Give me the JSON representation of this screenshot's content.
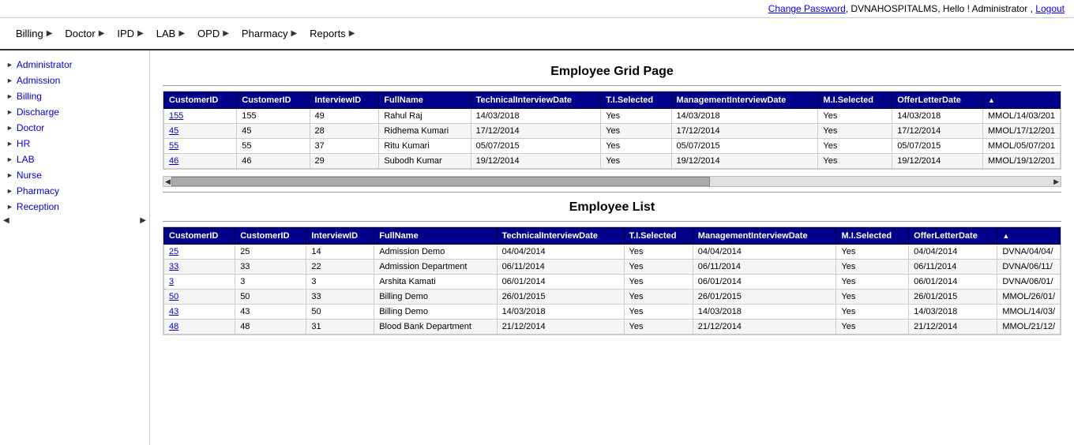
{
  "topbar": {
    "change_password": "Change Password",
    "hospital": "DVNAHOSPITALMS",
    "hello": "Hello ! Administrator",
    "logout": "Logout"
  },
  "nav": {
    "items": [
      {
        "label": "Billing",
        "id": "billing"
      },
      {
        "label": "Doctor",
        "id": "doctor"
      },
      {
        "label": "IPD",
        "id": "ipd"
      },
      {
        "label": "LAB",
        "id": "lab"
      },
      {
        "label": "OPD",
        "id": "opd"
      },
      {
        "label": "Pharmacy",
        "id": "pharmacy"
      },
      {
        "label": "Reports",
        "id": "reports"
      }
    ]
  },
  "sidebar": {
    "items": [
      {
        "label": "Administrator",
        "id": "administrator"
      },
      {
        "label": "Admission",
        "id": "admission"
      },
      {
        "label": "Billing",
        "id": "billing"
      },
      {
        "label": "Discharge",
        "id": "discharge"
      },
      {
        "label": "Doctor",
        "id": "doctor"
      },
      {
        "label": "HR",
        "id": "hr"
      },
      {
        "label": "LAB",
        "id": "lab"
      },
      {
        "label": "Nurse",
        "id": "nurse"
      },
      {
        "label": "Pharmacy",
        "id": "pharmacy"
      },
      {
        "label": "Reception",
        "id": "reception"
      }
    ]
  },
  "employee_grid": {
    "title": "Employee Grid Page",
    "columns": [
      "CustomerID",
      "CustomerID",
      "InterviewID",
      "FullName",
      "TechnicalInterviewDate",
      "T.I.Selected",
      "ManagementInterviewDate",
      "M.I.Selected",
      "OfferLetterDate",
      ""
    ],
    "rows": [
      {
        "id": "155",
        "cid": "155",
        "iid": "49",
        "name": "Rahul Raj",
        "tid": "14/03/2018",
        "tis": "Yes",
        "mid": "14/03/2018",
        "mis": "Yes",
        "old": "14/03/2018",
        "ol": "MMOL/14/03/201"
      },
      {
        "id": "45",
        "cid": "45",
        "iid": "28",
        "name": "Ridhema Kumari",
        "tid": "17/12/2014",
        "tis": "Yes",
        "mid": "17/12/2014",
        "mis": "Yes",
        "old": "17/12/2014",
        "ol": "MMOL/17/12/201"
      },
      {
        "id": "55",
        "cid": "55",
        "iid": "37",
        "name": "Ritu Kumari",
        "tid": "05/07/2015",
        "tis": "Yes",
        "mid": "05/07/2015",
        "mis": "Yes",
        "old": "05/07/2015",
        "ol": "MMOL/05/07/201"
      },
      {
        "id": "46",
        "cid": "46",
        "iid": "29",
        "name": "Subodh Kumar",
        "tid": "19/12/2014",
        "tis": "Yes",
        "mid": "19/12/2014",
        "mis": "Yes",
        "old": "19/12/2014",
        "ol": "MMOL/19/12/201"
      }
    ]
  },
  "employee_list": {
    "title": "Employee List",
    "columns": [
      "CustomerID",
      "CustomerID",
      "InterviewID",
      "FullName",
      "TechnicalInterviewDate",
      "T.I.Selected",
      "ManagementInterviewDate",
      "M.I.Selected",
      "OfferLetterDate",
      ""
    ],
    "rows": [
      {
        "id": "25",
        "cid": "25",
        "iid": "14",
        "name": "Admission Demo",
        "tid": "04/04/2014",
        "tis": "Yes",
        "mid": "04/04/2014",
        "mis": "Yes",
        "old": "04/04/2014",
        "ol": "DVNA/04/04/"
      },
      {
        "id": "33",
        "cid": "33",
        "iid": "22",
        "name": "Admission Department",
        "tid": "06/11/2014",
        "tis": "Yes",
        "mid": "06/11/2014",
        "mis": "Yes",
        "old": "06/11/2014",
        "ol": "DVNA/06/11/"
      },
      {
        "id": "3",
        "cid": "3",
        "iid": "3",
        "name": "Arshita Kamati",
        "tid": "06/01/2014",
        "tis": "Yes",
        "mid": "06/01/2014",
        "mis": "Yes",
        "old": "06/01/2014",
        "ol": "DVNA/06/01/"
      },
      {
        "id": "50",
        "cid": "50",
        "iid": "33",
        "name": "Billing Demo",
        "tid": "26/01/2015",
        "tis": "Yes",
        "mid": "26/01/2015",
        "mis": "Yes",
        "old": "26/01/2015",
        "ol": "MMOL/26/01/"
      },
      {
        "id": "43",
        "cid": "43",
        "iid": "50",
        "name": "Billing Demo",
        "tid": "14/03/2018",
        "tis": "Yes",
        "mid": "14/03/2018",
        "mis": "Yes",
        "old": "14/03/2018",
        "ol": "MMOL/14/03/"
      },
      {
        "id": "48",
        "cid": "48",
        "iid": "31",
        "name": "Blood Bank Department",
        "tid": "21/12/2014",
        "tis": "Yes",
        "mid": "21/12/2014",
        "mis": "Yes",
        "old": "21/12/2014",
        "ol": "MMOL/21/12/"
      }
    ]
  }
}
